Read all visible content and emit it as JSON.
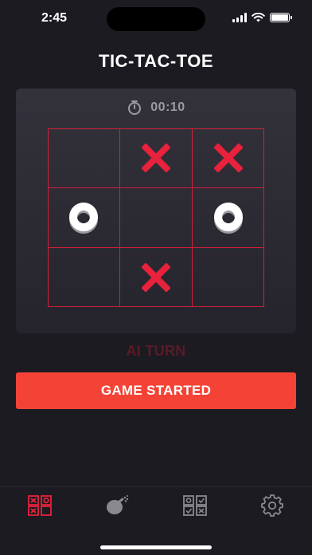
{
  "status_bar": {
    "time": "2:45"
  },
  "app": {
    "title": "TIC-TAC-TOE"
  },
  "timer": {
    "icon": "stopwatch-icon",
    "value": "00:10"
  },
  "board": {
    "cells": [
      "",
      "X",
      "X",
      "O",
      "",
      "O",
      "",
      "X",
      ""
    ]
  },
  "turn": {
    "label": "AI TURN"
  },
  "action": {
    "button_label": "GAME STARTED"
  },
  "tabs": [
    {
      "name": "tic-tac-toe-grid-icon",
      "active": true
    },
    {
      "name": "bomb-icon",
      "active": false
    },
    {
      "name": "checklist-grid-icon",
      "active": false
    },
    {
      "name": "gear-icon",
      "active": false
    }
  ],
  "colors": {
    "accent": "#f44336",
    "board_line": "#d01f3c",
    "x_mark": "#e8213c",
    "turn_label": "#5a1a26",
    "background": "#1c1b22"
  }
}
